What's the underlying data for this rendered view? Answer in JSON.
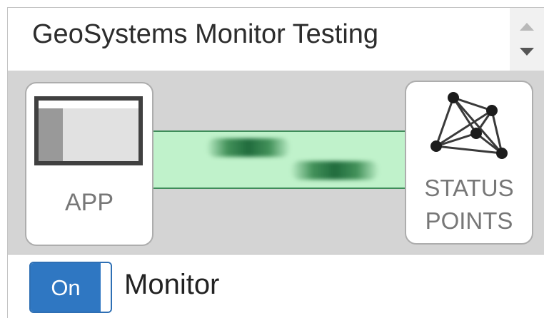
{
  "header": {
    "selected_monitor": "GeoSystems Monitor Testing",
    "spinner_up_icon": "triangle-up-icon",
    "spinner_down_icon": "triangle-down-icon"
  },
  "diagram": {
    "app_node": {
      "label": "APP",
      "icon": "app-window-icon"
    },
    "status_node": {
      "label_line1": "STATUS",
      "label_line2": "POINTS",
      "icon": "network-graph-icon"
    },
    "link": {
      "color": "#c0f2cb",
      "border_color": "#3f8d5a",
      "pulse_color": "#1f6b3c"
    }
  },
  "monitor_toggle": {
    "state_label": "On",
    "label": "Monitor",
    "on_color": "#2f77c2"
  }
}
